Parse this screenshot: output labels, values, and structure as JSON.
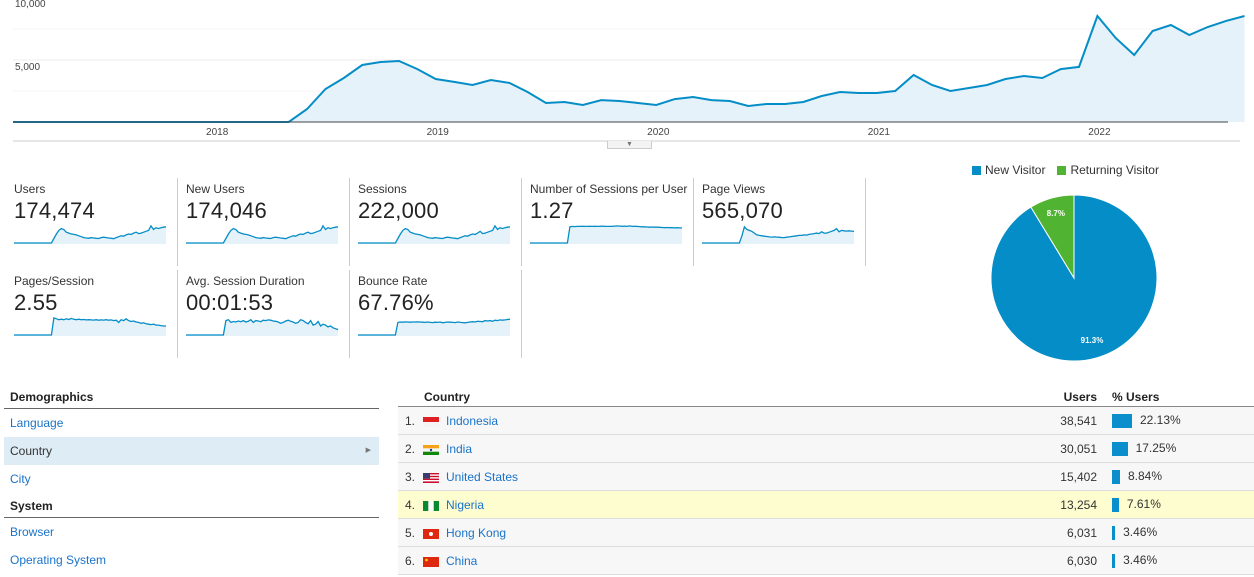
{
  "main_chart": {
    "type": "area",
    "y_ticks": [
      "10,000",
      "5,000"
    ],
    "y_tick_values": [
      10000,
      5000
    ],
    "ylim": [
      0,
      10000
    ],
    "x_labels": [
      "2018",
      "2019",
      "2020",
      "2021",
      "2022"
    ],
    "x_label_months": [
      11,
      23,
      35,
      47,
      59
    ],
    "color": "#058dc7",
    "fill": "#e5f2f9",
    "values": [
      0,
      0,
      0,
      0,
      0,
      0,
      0,
      0,
      0,
      0,
      0,
      0,
      0,
      0,
      0,
      0,
      1050,
      2660,
      3550,
      4600,
      4840,
      4920,
      4270,
      3470,
      3230,
      2980,
      3390,
      3150,
      2420,
      1530,
      1610,
      1370,
      1770,
      1690,
      1530,
      1370,
      1850,
      2020,
      1770,
      1690,
      1290,
      1450,
      1450,
      1610,
      2100,
      2420,
      2340,
      2340,
      2500,
      3790,
      2980,
      2500,
      2740,
      2980,
      3470,
      3710,
      3550,
      4270,
      4440,
      8550,
      6770,
      5400,
      7340,
      7820,
      7020,
      7660,
      8150,
      8550
    ]
  },
  "toggle": {
    "icon": "caret-down-icon",
    "glyph": "▼"
  },
  "metrics": [
    {
      "label": "Users",
      "value": "174,474",
      "spark": [
        0,
        0,
        0,
        0,
        0,
        0,
        0,
        0,
        0,
        0,
        0,
        0,
        0,
        0,
        0,
        0,
        25,
        50,
        70,
        80,
        75,
        60,
        55,
        50,
        48,
        45,
        40,
        35,
        30,
        28,
        26,
        30,
        28,
        26,
        25,
        30,
        32,
        30,
        28,
        26,
        24,
        30,
        35,
        40,
        38,
        45,
        50,
        48,
        55,
        60,
        52,
        55,
        60,
        65,
        70,
        95,
        75,
        85,
        80,
        85,
        88,
        90
      ]
    },
    {
      "label": "New Users",
      "value": "174,046",
      "spark": [
        0,
        0,
        0,
        0,
        0,
        0,
        0,
        0,
        0,
        0,
        0,
        0,
        0,
        0,
        0,
        0,
        25,
        50,
        70,
        80,
        75,
        60,
        55,
        50,
        48,
        45,
        40,
        35,
        30,
        28,
        26,
        30,
        28,
        26,
        25,
        30,
        32,
        30,
        28,
        26,
        24,
        30,
        35,
        40,
        38,
        45,
        50,
        48,
        55,
        60,
        52,
        55,
        60,
        65,
        70,
        95,
        75,
        85,
        80,
        85,
        88,
        90
      ]
    },
    {
      "label": "Sessions",
      "value": "222,000",
      "spark": [
        0,
        0,
        0,
        0,
        0,
        0,
        0,
        0,
        0,
        0,
        0,
        0,
        0,
        0,
        0,
        0,
        25,
        50,
        70,
        80,
        75,
        60,
        55,
        50,
        48,
        45,
        40,
        35,
        30,
        28,
        26,
        30,
        28,
        26,
        25,
        30,
        32,
        30,
        28,
        26,
        24,
        30,
        35,
        40,
        38,
        45,
        50,
        48,
        55,
        65,
        52,
        55,
        60,
        65,
        70,
        95,
        75,
        85,
        80,
        85,
        88,
        90
      ]
    },
    {
      "label": "Number of Sessions per User",
      "value": "1.27",
      "spark": [
        0,
        0,
        0,
        0,
        0,
        0,
        0,
        0,
        0,
        0,
        0,
        0,
        0,
        0,
        0,
        0,
        90,
        92,
        91,
        92,
        92,
        93,
        92,
        92,
        93,
        92,
        93,
        92,
        93,
        94,
        93,
        92,
        92,
        93,
        94,
        95,
        94,
        93,
        94,
        92,
        95,
        92,
        93,
        92,
        91,
        90,
        90,
        89,
        88,
        89,
        88,
        88,
        87,
        86,
        85,
        86,
        85,
        85,
        84,
        85,
        84,
        84
      ]
    },
    {
      "label": "Page Views",
      "value": "565,070",
      "spark": [
        0,
        0,
        0,
        0,
        0,
        0,
        0,
        0,
        0,
        0,
        0,
        0,
        0,
        0,
        0,
        0,
        40,
        90,
        75,
        70,
        65,
        55,
        45,
        42,
        40,
        38,
        36,
        34,
        33,
        34,
        33,
        32,
        30,
        30,
        32,
        34,
        36,
        38,
        40,
        42,
        43,
        45,
        44,
        48,
        50,
        52,
        55,
        52,
        62,
        55,
        55,
        60,
        65,
        70,
        80,
        62,
        70,
        68,
        66,
        68,
        66,
        65
      ]
    },
    {
      "label": "Pages/Session",
      "value": "2.55",
      "spark": [
        0,
        0,
        0,
        0,
        0,
        0,
        0,
        0,
        0,
        0,
        0,
        0,
        0,
        0,
        0,
        0,
        95,
        90,
        85,
        88,
        85,
        90,
        86,
        92,
        87,
        85,
        88,
        85,
        86,
        84,
        85,
        84,
        83,
        85,
        82,
        84,
        83,
        85,
        82,
        84,
        80,
        82,
        70,
        85,
        80,
        90,
        80,
        75,
        78,
        72,
        70,
        65,
        68,
        62,
        60,
        58,
        60,
        55,
        55,
        52,
        50,
        50
      ]
    },
    {
      "label": "Avg. Session Duration",
      "value": "00:01:53",
      "spark": [
        0,
        0,
        0,
        0,
        0,
        0,
        0,
        0,
        0,
        0,
        0,
        0,
        0,
        0,
        0,
        0,
        80,
        85,
        70,
        75,
        72,
        78,
        74,
        80,
        72,
        76,
        85,
        70,
        80,
        78,
        74,
        82,
        80,
        84,
        82,
        78,
        76,
        72,
        65,
        70,
        78,
        82,
        76,
        72,
        65,
        70,
        85,
        80,
        70,
        62,
        80,
        55,
        60,
        75,
        50,
        60,
        55,
        45,
        50,
        40,
        35,
        30
      ]
    },
    {
      "label": "Bounce Rate",
      "value": "67.76%",
      "spark": [
        0,
        0,
        0,
        0,
        0,
        0,
        0,
        0,
        0,
        0,
        0,
        0,
        0,
        0,
        0,
        0,
        70,
        72,
        71,
        73,
        72,
        71,
        72,
        72,
        73,
        72,
        71,
        70,
        72,
        70,
        69,
        71,
        70,
        72,
        68,
        70,
        72,
        71,
        70,
        69,
        72,
        70,
        69,
        68,
        70,
        72,
        74,
        72,
        76,
        75,
        74,
        80,
        78,
        80,
        76,
        82,
        80,
        84,
        82,
        84,
        86,
        88
      ]
    }
  ],
  "pie": {
    "legend": [
      {
        "label": "New Visitor",
        "color": "#058dc7"
      },
      {
        "label": "Returning Visitor",
        "color": "#50b432"
      }
    ],
    "chart_data": {
      "type": "pie",
      "slices": [
        {
          "label": "New Visitor",
          "value": 91.3,
          "text": "91.3%",
          "color": "#058dc7"
        },
        {
          "label": "Returning Visitor",
          "value": 8.7,
          "text": "8.7%",
          "color": "#50b432"
        }
      ]
    }
  },
  "sidebar": {
    "sections": [
      {
        "title": "Demographics",
        "items": [
          {
            "label": "Language",
            "active": false
          },
          {
            "label": "Country",
            "active": true
          },
          {
            "label": "City",
            "active": false
          }
        ]
      },
      {
        "title": "System",
        "items": [
          {
            "label": "Browser",
            "active": false
          },
          {
            "label": "Operating System",
            "active": false
          }
        ]
      }
    ],
    "active_arrow": "▶"
  },
  "table": {
    "headers": {
      "country": "Country",
      "users": "Users",
      "pct_users": "% Users"
    },
    "rows": [
      {
        "rank": "1.",
        "country": "Indonesia",
        "flag": "id",
        "users": "38,541",
        "pct": "22.13%",
        "pct_value": 22.13,
        "highlight": false
      },
      {
        "rank": "2.",
        "country": "India",
        "flag": "in",
        "users": "30,051",
        "pct": "17.25%",
        "pct_value": 17.25,
        "highlight": false
      },
      {
        "rank": "3.",
        "country": "United States",
        "flag": "us",
        "users": "15,402",
        "pct": "8.84%",
        "pct_value": 8.84,
        "highlight": false
      },
      {
        "rank": "4.",
        "country": "Nigeria",
        "flag": "ng",
        "users": "13,254",
        "pct": "7.61%",
        "pct_value": 7.61,
        "highlight": true
      },
      {
        "rank": "5.",
        "country": "Hong Kong",
        "flag": "hk",
        "users": "6,031",
        "pct": "3.46%",
        "pct_value": 3.46,
        "highlight": false
      },
      {
        "rank": "6.",
        "country": "China",
        "flag": "cn",
        "users": "6,030",
        "pct": "3.46%",
        "pct_value": 3.46,
        "highlight": false
      }
    ]
  }
}
